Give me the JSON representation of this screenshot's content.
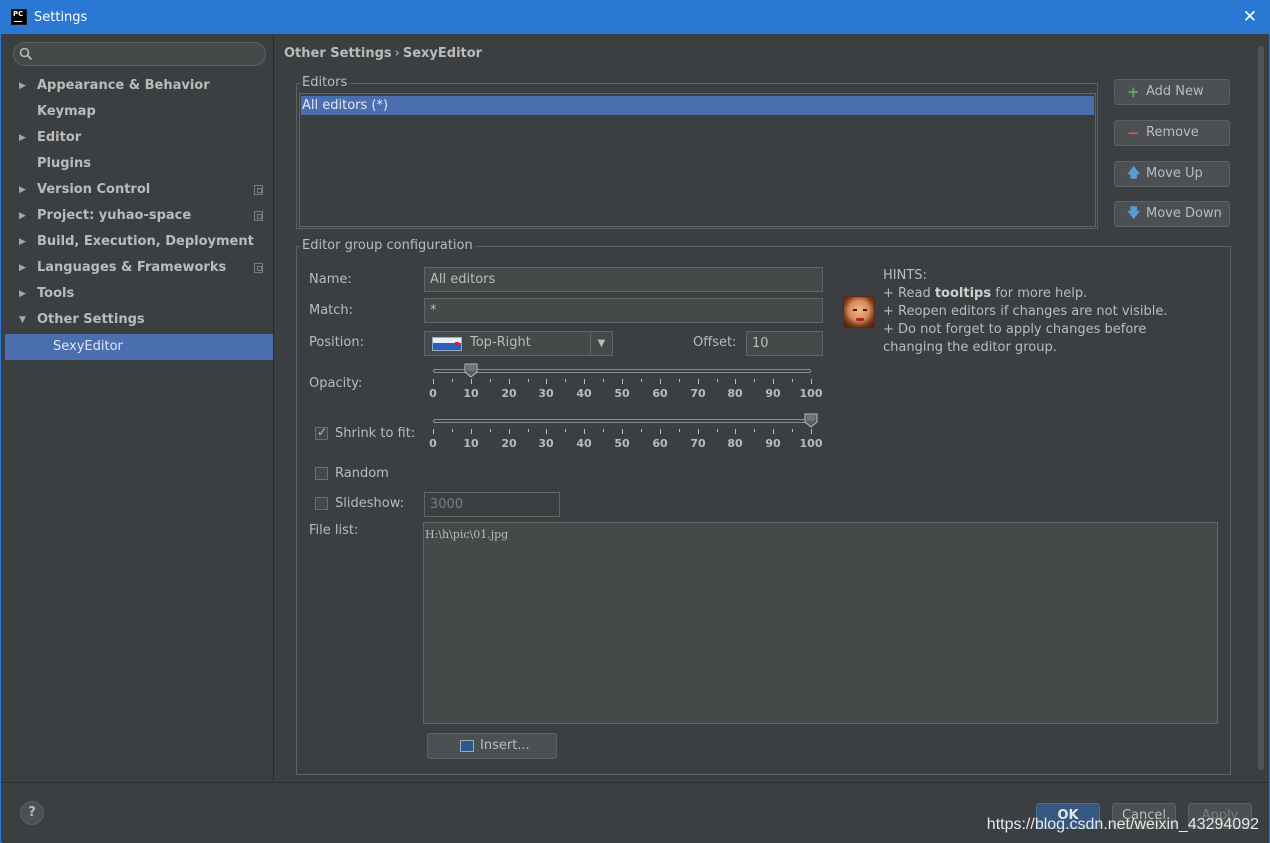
{
  "window": {
    "title": "Settings",
    "app_icon_text": "PC"
  },
  "search": {
    "placeholder": ""
  },
  "sidebar": {
    "items": [
      {
        "label": "Appearance & Behavior",
        "expandable": true,
        "expanded": false
      },
      {
        "label": "Keymap",
        "expandable": false
      },
      {
        "label": "Editor",
        "expandable": true,
        "expanded": false
      },
      {
        "label": "Plugins",
        "expandable": false
      },
      {
        "label": "Version Control",
        "expandable": true,
        "expanded": false,
        "project_icon": true
      },
      {
        "label": "Project: yuhao-space",
        "expandable": true,
        "expanded": false,
        "project_icon": true
      },
      {
        "label": "Build, Execution, Deployment",
        "expandable": true,
        "expanded": false
      },
      {
        "label": "Languages & Frameworks",
        "expandable": true,
        "expanded": false,
        "project_icon": true
      },
      {
        "label": "Tools",
        "expandable": true,
        "expanded": false
      },
      {
        "label": "Other Settings",
        "expandable": true,
        "expanded": true
      },
      {
        "label": "SexyEditor",
        "selected": true
      }
    ]
  },
  "breadcrumb": {
    "parent": "Other Settings",
    "separator": "›",
    "current": "SexyEditor"
  },
  "editors": {
    "group_title": "Editors",
    "list": [
      "All editors (*)"
    ],
    "buttons": {
      "add": "Add New",
      "remove": "Remove",
      "move_up": "Move Up",
      "move_down": "Move Down"
    }
  },
  "config": {
    "group_title": "Editor group configuration",
    "name_label": "Name:",
    "name_value": "All editors",
    "match_label": "Match:",
    "match_value": "*",
    "position_label": "Position:",
    "position_value": "Top-Right",
    "offset_label": "Offset:",
    "offset_value": "10",
    "opacity_label": "Opacity:",
    "opacity_value": 10,
    "shrink_label": "Shrink to fit:",
    "shrink_checked": true,
    "shrink_value": 100,
    "slider_ticks": [
      "0",
      "10",
      "20",
      "30",
      "40",
      "50",
      "60",
      "70",
      "80",
      "90",
      "100"
    ],
    "random_label": "Random",
    "random_checked": false,
    "slideshow_label": "Slideshow:",
    "slideshow_checked": false,
    "slideshow_value": "3000",
    "filelist_label": "File list:",
    "filelist_value": "H:\\h\\pic\\01.jpg",
    "insert_label": "Insert..."
  },
  "hints": {
    "title": "HINTS:",
    "line1_prefix": "+ Read ",
    "line1_bold": "tooltips",
    "line1_suffix": " for more help.",
    "line2": "+ Reopen editors if changes are not visible.",
    "line3": "+ Do not forget to apply changes before",
    "line4": "changing the editor group."
  },
  "footer": {
    "help": "?",
    "ok": "OK",
    "cancel": "Cancel",
    "apply": "Apply",
    "watermark": "https://blog.csdn.net/weixin_43294092"
  },
  "colors": {
    "accent": "#2b78d4",
    "selection": "#4b6eaf",
    "background": "#3c3f41"
  }
}
